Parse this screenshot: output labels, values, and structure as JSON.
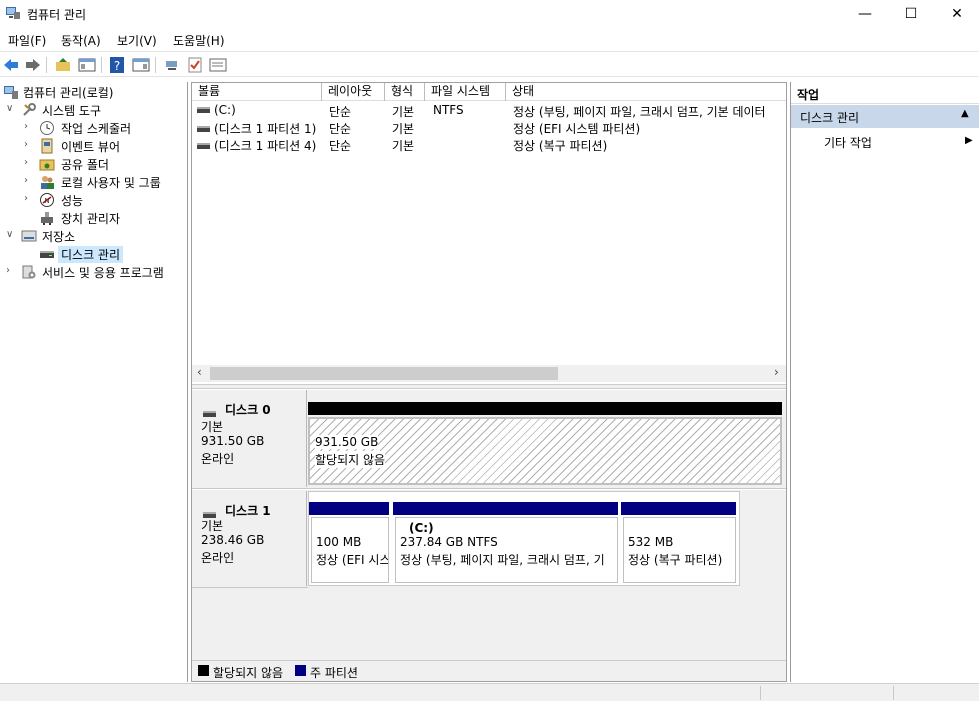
{
  "window": {
    "title": "컴퓨터 관리",
    "min": "—",
    "max": "☐",
    "close": "✕"
  },
  "menu": [
    "파일(F)",
    "동작(A)",
    "보기(V)",
    "도움말(H)"
  ],
  "tree": {
    "root": "컴퓨터 관리(로컬)",
    "system_tools": "시스템 도구",
    "task_scheduler": "작업 스케줄러",
    "event_viewer": "이벤트 뷰어",
    "shared_folders": "공유 폴더",
    "local_users": "로컬 사용자 및 그룹",
    "performance": "성능",
    "device_manager": "장치 관리자",
    "storage": "저장소",
    "disk_management": "디스크 관리",
    "services": "서비스 및 응용 프로그램"
  },
  "volumes": {
    "headers": [
      "볼륨",
      "레이아웃",
      "형식",
      "파일 시스템",
      "상태"
    ],
    "rows": [
      {
        "name": "(C:)",
        "layout": "단순",
        "type": "기본",
        "fs": "NTFS",
        "status": "정상 (부팅, 페이지 파일, 크래시 덤프, 기본 데이터"
      },
      {
        "name": "(디스크 1 파티션 1)",
        "layout": "단순",
        "type": "기본",
        "fs": "",
        "status": "정상 (EFI 시스템 파티션)"
      },
      {
        "name": "(디스크 1 파티션 4)",
        "layout": "단순",
        "type": "기본",
        "fs": "",
        "status": "정상 (복구 파티션)"
      }
    ]
  },
  "disks": {
    "disk0": {
      "name": "디스크 0",
      "type": "기본",
      "size": "931.50 GB",
      "state": "온라인",
      "part": {
        "size": "931.50 GB",
        "status": "할당되지 않음"
      }
    },
    "disk1": {
      "name": "디스크 1",
      "type": "기본",
      "size": "238.46 GB",
      "state": "온라인",
      "p1": {
        "size": "100 MB",
        "status": "정상 (EFI 시스"
      },
      "p2": {
        "name": "(C:)",
        "size": "237.84 GB NTFS",
        "status": "정상 (부팅, 페이지 파일, 크래시 덤프, 기"
      },
      "p3": {
        "size": "532 MB",
        "status": "정상 (복구 파티션)"
      }
    }
  },
  "legend": {
    "unallocated": "할당되지 않음",
    "primary": "주 파티션"
  },
  "actions": {
    "title": "작업",
    "section": "디스크 관리",
    "more": "기타 작업"
  },
  "colors": {
    "primary_partition": "#000080",
    "unallocated": "#000000",
    "action_section": "#c8d8ea"
  }
}
